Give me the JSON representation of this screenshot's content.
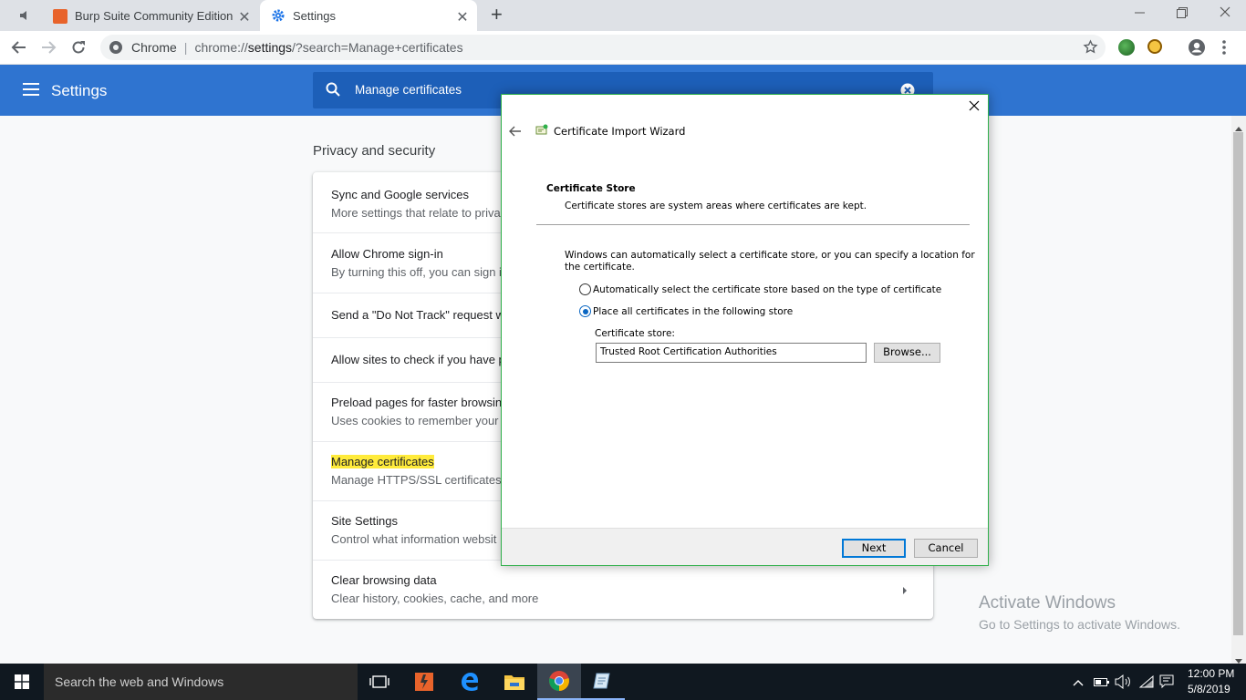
{
  "browser": {
    "tabs": [
      {
        "label": "Burp Suite Community Edition",
        "active": false
      },
      {
        "label": "Settings",
        "active": true
      }
    ],
    "url_origin": "Chrome",
    "url_scheme_host": "chrome://",
    "url_host": "settings",
    "url_path": "/?search=Manage+certificates",
    "new_tab_symbol": "+",
    "close_symbol": "✕"
  },
  "settings": {
    "title": "Settings",
    "search_value": "Manage certificates",
    "section_title": "Privacy and security",
    "rows": [
      {
        "title": "Sync and Google services",
        "subtitle": "More settings that relate to priva"
      },
      {
        "title": "Allow Chrome sign-in",
        "subtitle": "By turning this off, you can sign i"
      },
      {
        "title": "Send a \"Do Not Track\" request w",
        "subtitle": ""
      },
      {
        "title": "Allow sites to check if you have p",
        "subtitle": ""
      },
      {
        "title": "Preload pages for faster browsin",
        "subtitle": "Uses cookies to remember your"
      },
      {
        "title": "Manage certificates",
        "subtitle": "Manage HTTPS/SSL certificates"
      },
      {
        "title": "Site Settings",
        "subtitle": "Control what information websit"
      },
      {
        "title": "Clear browsing data",
        "subtitle": "Clear history, cookies, cache, and more"
      }
    ]
  },
  "wizard": {
    "title": "Certificate Import Wizard",
    "heading": "Certificate Store",
    "subheading": "Certificate stores are system areas where certificates are kept.",
    "description_line1": "Windows can automatically select a certificate store, or you can specify a location for",
    "description_line2": "the certificate.",
    "option_auto": "Automatically select the certificate store based on the type of certificate",
    "option_manual": "Place all certificates in the following store",
    "store_label": "Certificate store:",
    "store_value": "Trusted Root Certification Authorities",
    "browse_label": "Browse...",
    "next_label": "Next",
    "cancel_label": "Cancel",
    "selected_option": "manual"
  },
  "watermark": {
    "line1": "Activate Windows",
    "line2": "Go to Settings to activate Windows."
  },
  "taskbar": {
    "search_placeholder": "Search the web and Windows",
    "time": "12:00 PM",
    "date": "5/8/2019"
  },
  "colors": {
    "settings_blue": "#2f74d0",
    "highlight": "#ffeb3b",
    "dialog_border": "#2fb04a",
    "taskbar": "#101820"
  }
}
